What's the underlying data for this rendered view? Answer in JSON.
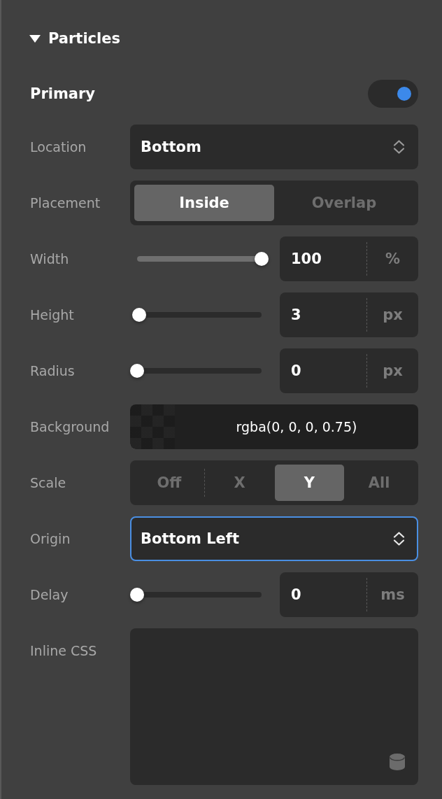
{
  "section": {
    "title": "Particles",
    "expanded": true
  },
  "primary": {
    "label": "Primary",
    "on": true
  },
  "rows": [
    {
      "kind": "select",
      "label": "Location",
      "value": "Bottom",
      "focused": false
    },
    {
      "kind": "segmented",
      "label": "Placement",
      "options": [
        {
          "label": "Inside",
          "selected": true
        },
        {
          "label": "Overlap",
          "selected": false
        }
      ]
    },
    {
      "kind": "slider",
      "label": "Width",
      "level": 1,
      "value": "100",
      "unit": "%"
    },
    {
      "kind": "slider",
      "label": "Height",
      "level": 0.015,
      "value": "3",
      "unit": "px"
    },
    {
      "kind": "slider",
      "label": "Radius",
      "level": 0,
      "value": "0",
      "unit": "px"
    },
    {
      "kind": "color",
      "label": "Background",
      "value": "rgba(0, 0, 0, 0.75)"
    },
    {
      "kind": "segmented",
      "label": "Scale",
      "options": [
        {
          "label": "Off",
          "selected": false
        },
        {
          "label": "X",
          "selected": false
        },
        {
          "label": "Y",
          "selected": true
        },
        {
          "label": "All",
          "selected": false
        }
      ]
    },
    {
      "kind": "select",
      "label": "Origin",
      "value": "Bottom Left",
      "focused": true
    },
    {
      "kind": "slider",
      "label": "Delay",
      "level": 0,
      "value": "0",
      "unit": "ms"
    },
    {
      "kind": "code",
      "label": "Inline CSS"
    }
  ]
}
